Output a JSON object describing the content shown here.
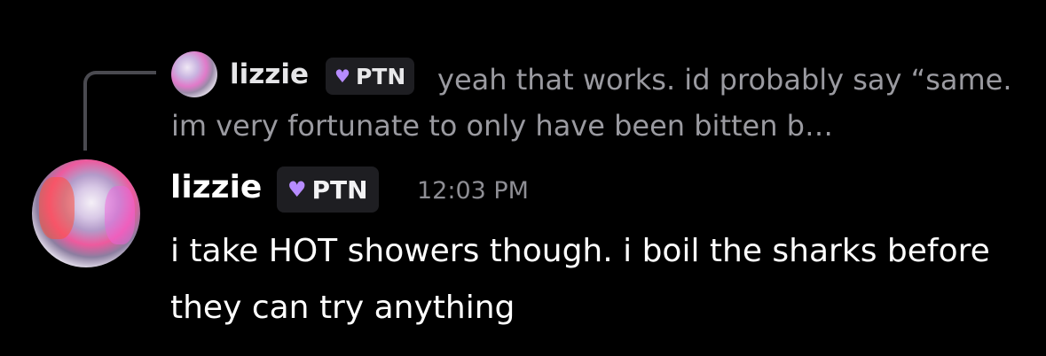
{
  "reply": {
    "author": "lizzie",
    "tag": "PTN",
    "text": "yeah that works. id probably say “same. im very fortunate to only have been bitten b…"
  },
  "message": {
    "author": "lizzie",
    "tag": "PTN",
    "timestamp": "12:03 PM",
    "text": "i take HOT showers though. i boil the sharks before they can try anything"
  },
  "icons": {
    "tag_icon": "purple-heart-icon"
  },
  "colors": {
    "background": "#000000",
    "tag_heart": "#b78cff",
    "reply_text": "#9a9aa0",
    "timestamp": "#8e8e94"
  }
}
